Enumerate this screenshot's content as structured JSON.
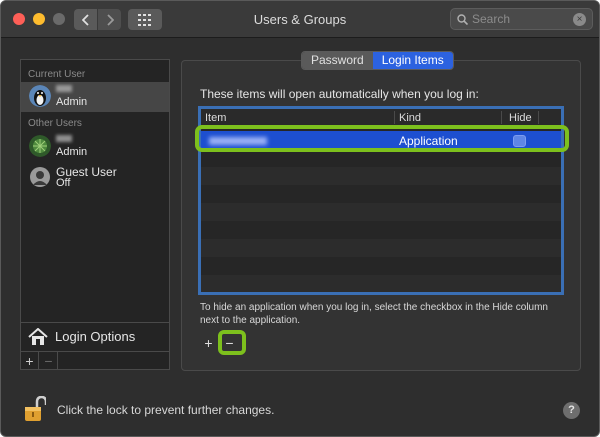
{
  "window": {
    "title": "Users & Groups"
  },
  "search": {
    "placeholder": "Search"
  },
  "sidebar": {
    "current_user_heading": "Current User",
    "other_users_heading": "Other Users",
    "current_user": {
      "role": "Admin"
    },
    "other_users": [
      {
        "role": "Admin"
      },
      {
        "name": "Guest User",
        "role": "Off"
      }
    ],
    "login_options": "Login Options",
    "add": "+",
    "remove": "−"
  },
  "tabs": [
    {
      "label": "Password",
      "active": false
    },
    {
      "label": "Login Items",
      "active": true
    }
  ],
  "login_items": {
    "intro": "These items will open automatically when you log in:",
    "columns": {
      "item": "Item",
      "kind": "Kind",
      "hide": "Hide"
    },
    "rows": [
      {
        "kind": "Application",
        "hide": false,
        "selected": true
      }
    ],
    "hint": "To hide an application when you log in, select the checkbox in the Hide column next to the application.",
    "add": "+",
    "remove": "−"
  },
  "footer": {
    "lock_text": "Click the lock to prevent further changes.",
    "help": "?"
  },
  "colors": {
    "accent": "#2c62e0",
    "selection": "#1d4fd0",
    "highlight_outline": "#7dc01d",
    "table_focus": "#3a6fb5"
  }
}
